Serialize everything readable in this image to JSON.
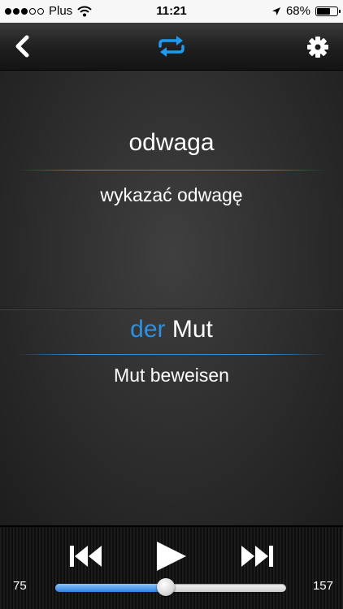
{
  "status_bar": {
    "carrier": "Plus",
    "signal_dots_filled": 3,
    "signal_dots_total": 5,
    "time": "11:21",
    "battery_percent": "68%",
    "battery_level": 0.68,
    "icons": [
      "wifi-icon",
      "location-arrow-icon",
      "battery-icon"
    ]
  },
  "nav_bar": {
    "icons": [
      "back-chevron-icon",
      "repeat-icon",
      "gear-icon"
    ],
    "accent_color": "#1e9bf0"
  },
  "card": {
    "source_word": "odwaga",
    "source_phrase": "wykazać odwagę",
    "target_article": "der",
    "target_word": "Mut",
    "target_phrase": "Mut beweisen",
    "source_line_color": "#2ea84a",
    "article_color": "#2f8fe0"
  },
  "player": {
    "icons": [
      "skip-back-icon",
      "play-icon",
      "skip-forward-icon"
    ],
    "current_index": "75",
    "total_count": "157",
    "progress_fraction": 0.48
  }
}
